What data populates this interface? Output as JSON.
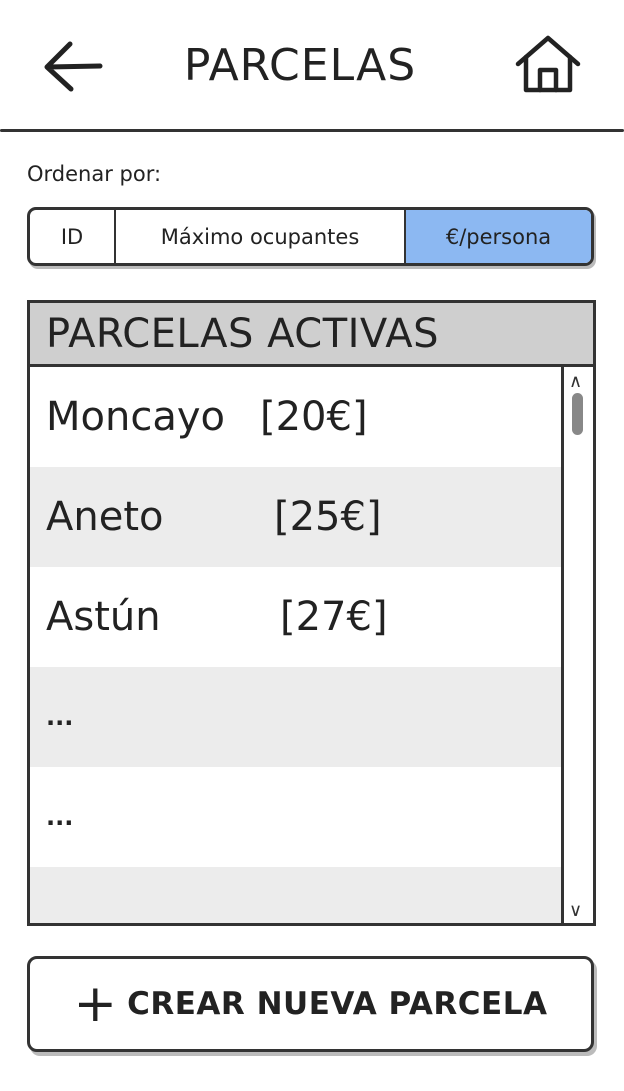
{
  "header": {
    "title": "PARCELAS",
    "back_icon": "arrow-left-icon",
    "home_icon": "home-icon"
  },
  "sort": {
    "label": "Ordenar por:",
    "options": [
      "ID",
      "Máximo ocupantes",
      "€/persona"
    ],
    "selected": "€/persona",
    "selected_color": "#8cb8f2"
  },
  "list": {
    "title": "PARCELAS ACTIVAS",
    "items": [
      {
        "name": "Moncayo",
        "price": "[20€]"
      },
      {
        "name": "Aneto",
        "price": "[25€]"
      },
      {
        "name": "Astún",
        "price": "[27€]"
      },
      {
        "name": "...",
        "price": ""
      },
      {
        "name": "...",
        "price": ""
      }
    ]
  },
  "create_button": {
    "plus": "+",
    "label": "CREAR NUEVA PARCELA"
  }
}
